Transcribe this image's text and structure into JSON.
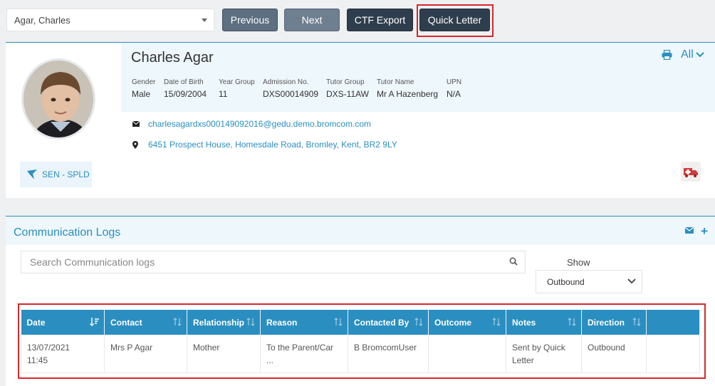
{
  "top_bar": {
    "student_select_value": "Agar, Charles",
    "previous_label": "Previous",
    "next_label": "Next",
    "ctf_export_label": "CTF Export",
    "quick_letter_label": "Quick Letter"
  },
  "profile": {
    "name": "Charles Agar",
    "all_label": "All",
    "fields": [
      {
        "label": "Gender",
        "value": "Male"
      },
      {
        "label": "Date of Birth",
        "value": "15/09/2004"
      },
      {
        "label": "Year Group",
        "value": "11"
      },
      {
        "label": "Admission No.",
        "value": "DXS00014909"
      },
      {
        "label": "Tutor Group",
        "value": "DXS-11AW"
      },
      {
        "label": "Tutor Name",
        "value": "Mr A Hazenberg"
      },
      {
        "label": "UPN",
        "value": "N/A"
      }
    ],
    "email": "charlesagardxs000149092016@gedu.demo.bromcom.com",
    "address": "6451 Prospect House, Homesdale Road, Bromley, Kent, BR2 9LY",
    "sen_badge": "SEN - SPLD"
  },
  "comm_logs": {
    "title": "Communication Logs",
    "search_placeholder": "Search Communication logs",
    "show_label": "Show",
    "show_value": "Outbound",
    "columns": [
      "Date",
      "Contact",
      "Relationship",
      "Reason",
      "Contacted By",
      "Outcome",
      "Notes",
      "Direction",
      ""
    ],
    "rows": [
      {
        "date_line1": "13/07/2021",
        "date_line2": "11:45",
        "contact": "Mrs P Agar",
        "relationship": "Mother",
        "reason_line1": "To the Parent/Car",
        "reason_line2": "...",
        "contacted_by": "B BromcomUser",
        "outcome": "",
        "notes_line1": "Sent by Quick",
        "notes_line2": "Letter",
        "direction": "Outbound"
      }
    ]
  },
  "colors": {
    "accent": "#2a8fc0",
    "highlight": "#d9262a",
    "dark_button": "#2f3e4d"
  }
}
